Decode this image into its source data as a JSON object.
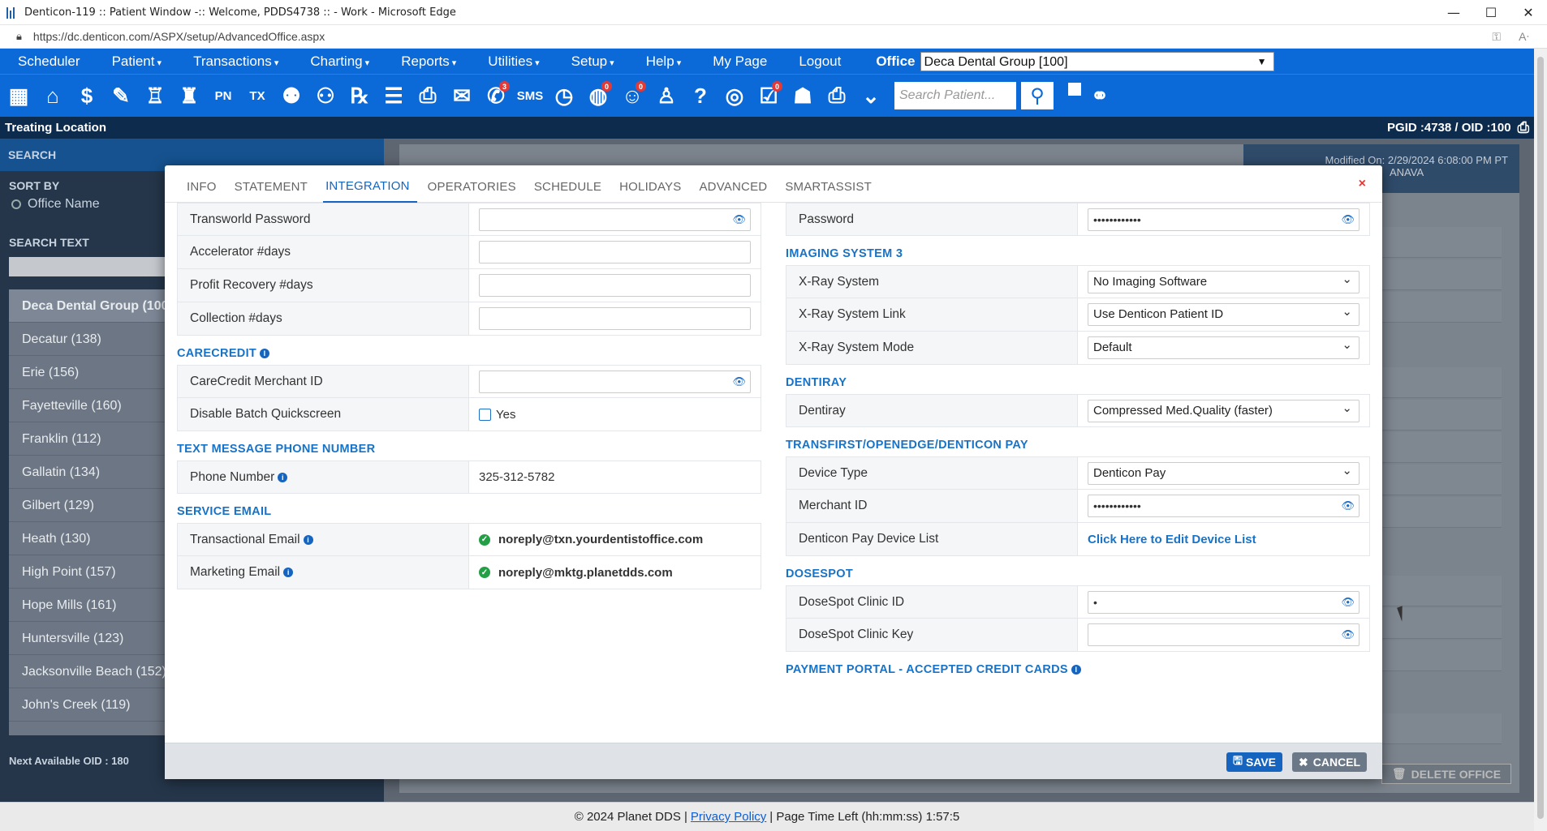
{
  "window": {
    "title": "Denticon-119 :: Patient Window -:: Welcome, PDDS4738 :: - Work - Microsoft Edge"
  },
  "address": {
    "url": "https://dc.denticon.com/ASPX/setup/AdvancedOffice.aspx"
  },
  "menu": {
    "items": [
      {
        "label": "Scheduler",
        "dropdown": false
      },
      {
        "label": "Patient",
        "dropdown": true
      },
      {
        "label": "Transactions",
        "dropdown": true
      },
      {
        "label": "Charting",
        "dropdown": true
      },
      {
        "label": "Reports",
        "dropdown": true
      },
      {
        "label": "Utilities",
        "dropdown": true
      },
      {
        "label": "Setup",
        "dropdown": true
      },
      {
        "label": "Help",
        "dropdown": true
      },
      {
        "label": "My Page",
        "dropdown": false
      },
      {
        "label": "Logout",
        "dropdown": false
      }
    ],
    "office_label": "Office",
    "office_value": "Deca Dental Group [100]"
  },
  "toolbar": {
    "icons": [
      {
        "name": "calendar-icon",
        "glyph": "▦"
      },
      {
        "name": "home-icon",
        "glyph": "⌂"
      },
      {
        "name": "dollar-icon",
        "glyph": "$"
      },
      {
        "name": "edit-icon",
        "glyph": "✎"
      },
      {
        "name": "tooth-icon",
        "glyph": "♖"
      },
      {
        "name": "implant-icon",
        "glyph": "♜"
      },
      {
        "name": "pn-icon",
        "glyph": "PN"
      },
      {
        "name": "tx-icon",
        "glyph": "TX"
      },
      {
        "name": "add-patient-icon",
        "glyph": "⚉"
      },
      {
        "name": "add-family-icon",
        "glyph": "⚇"
      },
      {
        "name": "rx-icon",
        "glyph": "℞"
      },
      {
        "name": "notes-icon",
        "glyph": "☰"
      },
      {
        "name": "printer-doc-icon",
        "glyph": "⎙"
      },
      {
        "name": "mail-icon",
        "glyph": "✉"
      },
      {
        "name": "chat-icon",
        "glyph": "✆",
        "badge": "3"
      },
      {
        "name": "sms-icon",
        "glyph": "SMS"
      },
      {
        "name": "clock-icon",
        "glyph": "◷"
      },
      {
        "name": "globe-badge-icon",
        "glyph": "◍",
        "badge": "0"
      },
      {
        "name": "support-icon",
        "glyph": "☺",
        "badge": "0"
      },
      {
        "name": "tooth-chart-icon",
        "glyph": "♙"
      },
      {
        "name": "help-tooth-icon",
        "glyph": "?"
      },
      {
        "name": "web-icon",
        "glyph": "◎"
      },
      {
        "name": "task-icon",
        "glyph": "☑",
        "badge": "0"
      },
      {
        "name": "group-icon",
        "glyph": "☗"
      },
      {
        "name": "print-icon",
        "glyph": "⎙"
      },
      {
        "name": "collapse-icon",
        "glyph": "⌄"
      }
    ],
    "search_placeholder": "Search Patient..."
  },
  "treating": {
    "label": "Treating Location",
    "pgid": "PGID :4738  /  OID :100"
  },
  "sidebar": {
    "search": "SEARCH",
    "sort_by": "SORT BY",
    "sort_option": "Office Name",
    "search_text": "SEARCH TEXT",
    "offices": [
      "Deca Dental Group (100)",
      "Decatur (138)",
      "Erie (156)",
      "Fayetteville (160)",
      "Franklin (112)",
      "Gallatin (134)",
      "Gilbert (129)",
      "Heath (130)",
      "High Point (157)",
      "Hope Mills (161)",
      "Huntersville (123)",
      "Jacksonville Beach (152)",
      "John's Creek (119)"
    ],
    "next_oid": "Next Available OID : 180"
  },
  "bg": {
    "modified": "Modified On: 2/29/2024 6:08:00 PM PT",
    "modified2": "ANAVA",
    "delete_office": "DELETE OFFICE"
  },
  "modal": {
    "tabs": [
      "INFO",
      "STATEMENT",
      "INTEGRATION",
      "OPERATORIES",
      "SCHEDULE",
      "HOLIDAYS",
      "ADVANCED",
      "SMARTASSIST"
    ],
    "active_tab": "INTEGRATION",
    "close": "×",
    "left": {
      "transworld_password": "Transworld Password",
      "accelerator": "Accelerator #days",
      "profit_recovery": "Profit Recovery #days",
      "collection": "Collection #days",
      "carecredit_title": "CARECREDIT",
      "carecredit_merchant": "CareCredit Merchant ID",
      "disable_batch": "Disable Batch Quickscreen",
      "disable_batch_yes": "Yes",
      "text_msg_title": "TEXT MESSAGE PHONE NUMBER",
      "phone_label": "Phone Number",
      "phone_value": "325-312-5782",
      "service_email_title": "SERVICE EMAIL",
      "transactional_label": "Transactional Email",
      "transactional_value": "noreply@txn.yourdentistoffice.com",
      "marketing_label": "Marketing Email",
      "marketing_value": "noreply@mktg.planetdds.com"
    },
    "right": {
      "password_label": "Password",
      "password_value": "••••••••••••",
      "imaging3_title": "IMAGING SYSTEM 3",
      "xray_system": "X-Ray System",
      "xray_system_value": "No Imaging Software",
      "xray_link": "X-Ray System Link",
      "xray_link_value": "Use Denticon Patient ID",
      "xray_mode": "X-Ray System Mode",
      "xray_mode_value": "Default",
      "dentiray_title": "DENTIRAY",
      "dentiray": "Dentiray",
      "dentiray_value": "Compressed Med.Quality (faster)",
      "transfirst_title": "TRANSFIRST/OPENEDGE/DENTICON PAY",
      "device_type": "Device Type",
      "device_type_value": "Denticon Pay",
      "merchant_id": "Merchant ID",
      "merchant_id_value": "••••••••••••",
      "device_list": "Denticon Pay Device List",
      "device_list_link": "Click Here to Edit Device List",
      "dosespot_title": "DOSESPOT",
      "dosespot_clinic_id": "DoseSpot Clinic ID",
      "dosespot_clinic_id_value": "•",
      "dosespot_clinic_key": "DoseSpot Clinic Key",
      "payment_portal_title": "PAYMENT PORTAL - ACCEPTED CREDIT CARDS"
    },
    "save": "SAVE",
    "cancel": "CANCEL"
  },
  "footer": {
    "copyright": "© 2024 Planet DDS |",
    "privacy": "Privacy Policy",
    "time_left": "| Page Time Left (hh:mm:ss) 1:57:5"
  }
}
